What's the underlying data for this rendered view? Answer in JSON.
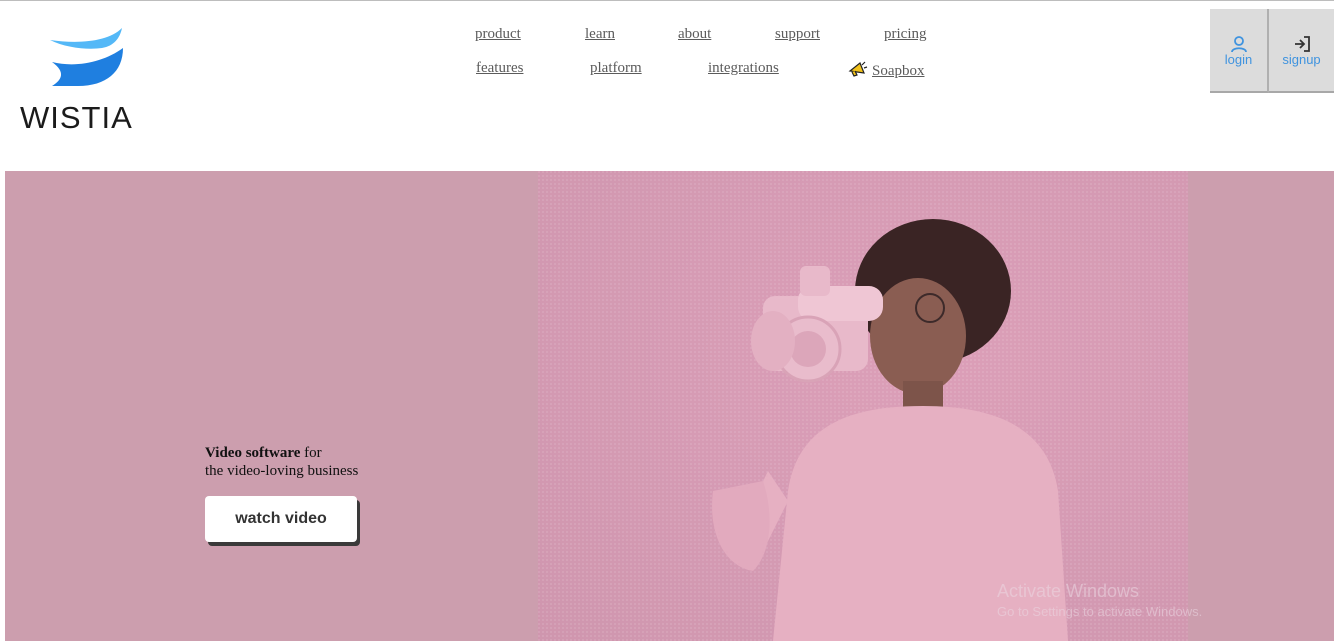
{
  "brand": {
    "name": "WISTIA",
    "accent": "#3f93df",
    "logo_colors": [
      "#54b8f7",
      "#1f7fe0"
    ]
  },
  "nav": {
    "row1": [
      "product",
      "learn",
      "about",
      "support",
      "pricing"
    ],
    "row2": [
      "features",
      "platform",
      "integrations"
    ],
    "soapbox": {
      "label": "Soapbox",
      "icon": "megaphone-icon"
    }
  },
  "auth": {
    "login": {
      "label": "login",
      "icon": "user-icon"
    },
    "signup": {
      "label": "signup",
      "icon": "sign-in-icon"
    }
  },
  "hero": {
    "bg_color": "#cc9eae",
    "tagline_bold": "Video software",
    "tagline_rest": " for",
    "tagline_line2": "the video-loving business",
    "cta_label": "watch video"
  },
  "watermark": {
    "line1": "Activate Windows",
    "line2": "Go to Settings to activate Windows."
  }
}
